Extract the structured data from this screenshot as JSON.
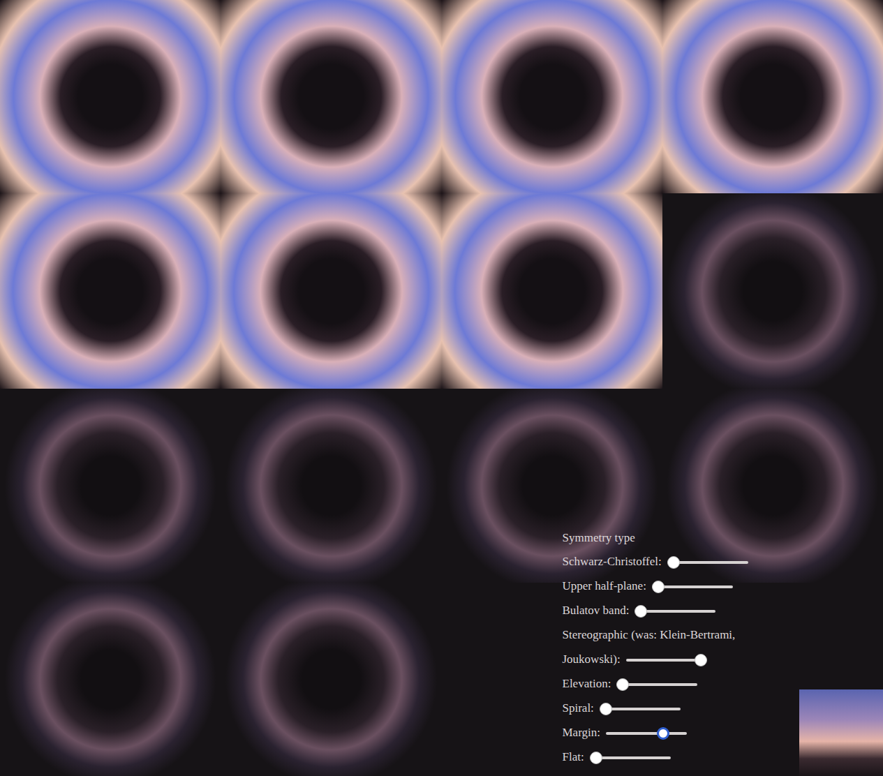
{
  "gallery": {
    "tiles": [
      {
        "kind": "bright"
      },
      {
        "kind": "bright"
      },
      {
        "kind": "bright"
      },
      {
        "kind": "bright"
      },
      {
        "kind": "bright"
      },
      {
        "kind": "bright"
      },
      {
        "kind": "bright"
      },
      {
        "kind": "dim"
      },
      {
        "kind": "dim"
      },
      {
        "kind": "dim"
      },
      {
        "kind": "dim"
      },
      {
        "kind": "dim"
      },
      {
        "kind": "dim"
      },
      {
        "kind": "dim"
      }
    ]
  },
  "controls": {
    "heading": "Symmetry type",
    "sliders": [
      {
        "label": "Schwarz-Christoffel:",
        "level": 0,
        "focused": false
      },
      {
        "label": "Upper half-plane:",
        "level": 0,
        "focused": false
      },
      {
        "label": "Bulatov band:",
        "level": 0,
        "focused": false
      },
      {
        "label": "Stereographic (was: Klein-Bertrami, Joukowski):",
        "level": 1,
        "focused": false
      },
      {
        "label": "Elevation:",
        "level": 0,
        "focused": false
      },
      {
        "label": "Spiral:",
        "level": 0,
        "focused": false
      },
      {
        "label": "Margin:",
        "level": 0.75,
        "focused": true
      },
      {
        "label": "Flat:",
        "level": 0,
        "focused": false
      }
    ]
  },
  "source_image": {
    "kind": "photo"
  }
}
